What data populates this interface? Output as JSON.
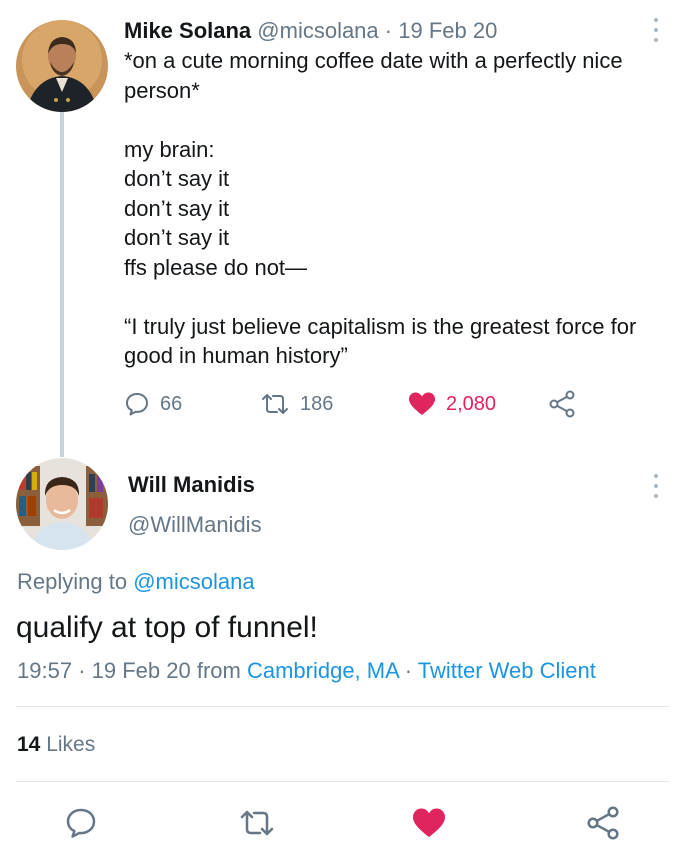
{
  "tweet1": {
    "author_name": "Mike Solana",
    "handle": "@micsolana",
    "separator": "·",
    "date": "19 Feb 20",
    "body_lines": [
      "*on a cute morning coffee date with a perfectly nice",
      "person*",
      "",
      "my brain:",
      "don’t say it",
      "don’t say it",
      "don’t say it",
      "ffs please do not—",
      "",
      "“I truly just believe capitalism is the greatest force for",
      "good in human history”"
    ],
    "replies": "66",
    "retweets": "186",
    "likes": "2,080",
    "icons": [
      "reply-icon",
      "retweet-icon",
      "heart-icon",
      "share-icon",
      "more-icon"
    ]
  },
  "tweet2": {
    "author_name": "Will Manidis",
    "handle": "@WillManidis",
    "replying_prefix": "Replying to",
    "replying_handle": "@micsolana",
    "text": "qualify at top of funnel!",
    "time": "19:57",
    "sep": "·",
    "date": "19 Feb 20 from",
    "location": "Cambridge, MA",
    "client_sep": "·",
    "client": "Twitter Web Client",
    "likes_count": "14",
    "likes_label": "Likes"
  },
  "colors": {
    "text": "#14171a",
    "secondary": "#657786",
    "link": "#1b95e0",
    "like": "#e0245e",
    "thread_line": "#c9d2d9"
  }
}
